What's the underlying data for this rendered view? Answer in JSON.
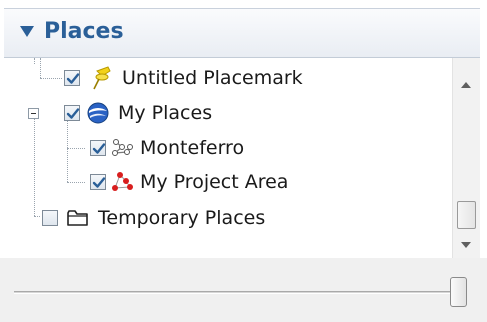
{
  "panel": {
    "title": "Places"
  },
  "tree": {
    "items": [
      {
        "label": "Untitled Placemark",
        "checked": true,
        "icon": "yellow-pushpin-icon"
      },
      {
        "label": "My Places",
        "checked": true,
        "icon": "earth-globe-icon",
        "expanded": true
      },
      {
        "label": "Monteferro",
        "checked": true,
        "icon": "path-nodes-icon"
      },
      {
        "label": "My Project Area",
        "checked": true,
        "icon": "red-polygon-nodes-icon"
      },
      {
        "label": "Temporary Places",
        "checked": false,
        "icon": "folder-icon"
      }
    ]
  },
  "scrollbar": {
    "position": 0.9
  },
  "slider": {
    "value": 1.0
  },
  "colors": {
    "header_text": "#2a5f98",
    "checkmark": "#2a5f98",
    "globe": "#2a62c4",
    "pushpin": "#f3d21a",
    "polygon_nodes": "#d81e1e"
  }
}
